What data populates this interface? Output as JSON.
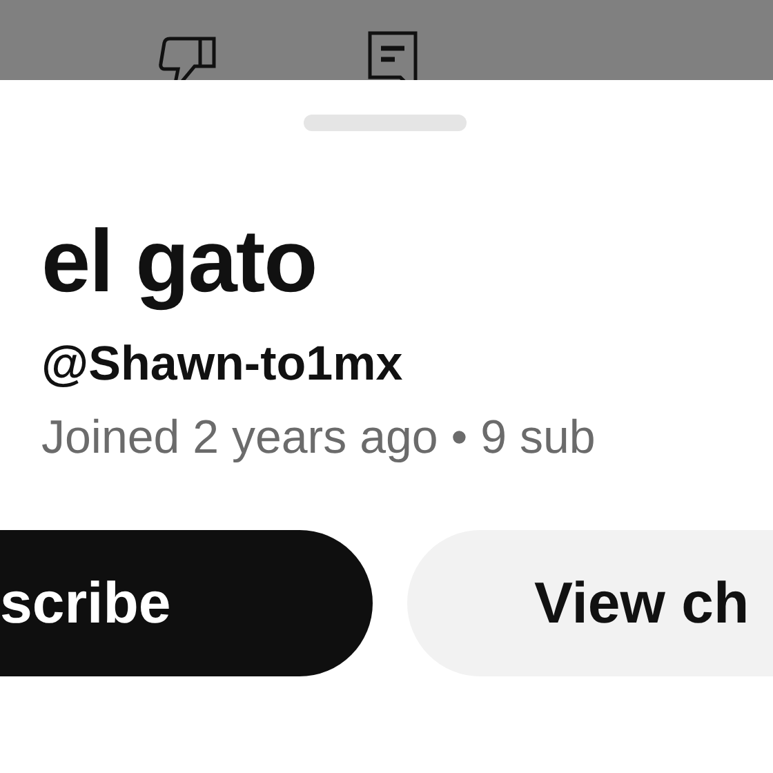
{
  "profile": {
    "name": "el gato",
    "handle": "@Shawn-to1mx",
    "meta": "Joined 2 years ago • 9 sub"
  },
  "buttons": [
    {
      "label": "scribe",
      "kind": "primary"
    },
    {
      "label": "View ch",
      "kind": "secondary"
    }
  ]
}
